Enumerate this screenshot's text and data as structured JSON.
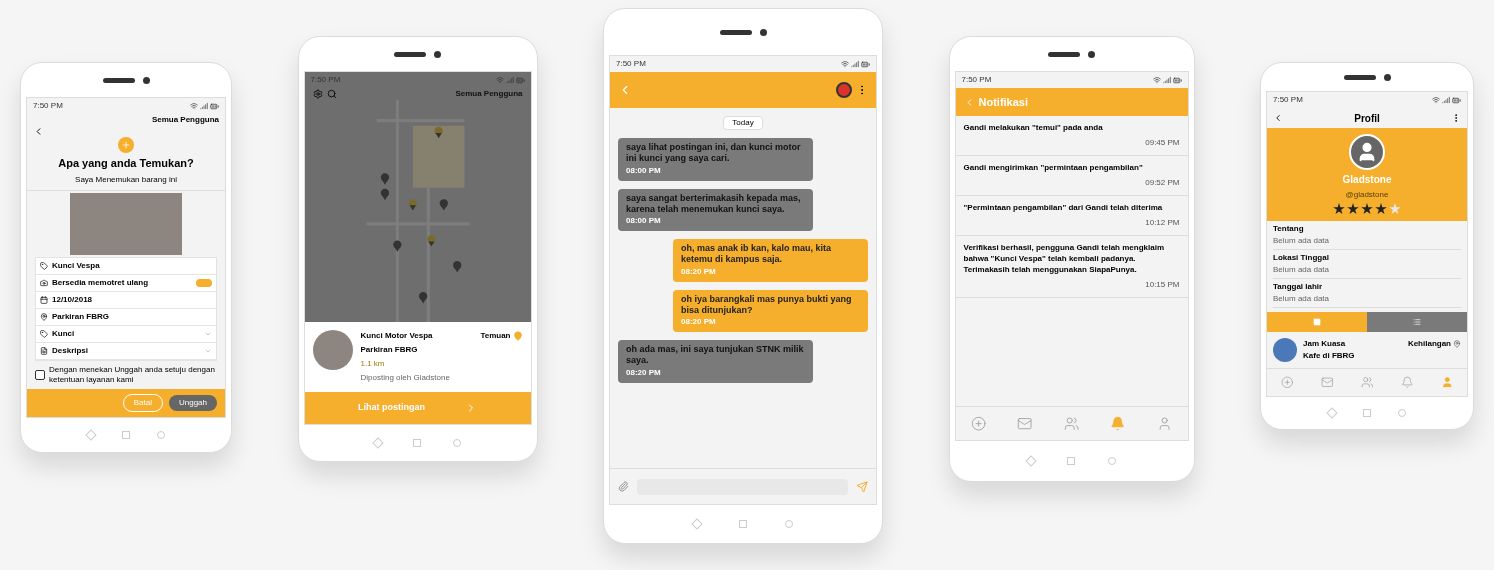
{
  "report_screen": {
    "status_time": "7:50 PM",
    "user_filter": "Semua Pengguna",
    "title": "Apa yang anda Temukan?",
    "subtitle": "Saya Menemukan barang ini",
    "fields": [
      {
        "kind": "text",
        "value": "Kunci Vespa"
      },
      {
        "kind": "toggle",
        "value": "Bersedia memotret ulang",
        "on": true
      },
      {
        "kind": "text",
        "value": "12/10/2018"
      },
      {
        "kind": "text",
        "value": "Parkiran FBRG"
      },
      {
        "kind": "select",
        "value": "Kunci"
      },
      {
        "kind": "select",
        "value": "Deskripsi"
      }
    ],
    "agreement": {
      "checked": false,
      "text": "Dengan menekan Unggah anda setuju dengan ketentuan layanan kami"
    },
    "buttons": [
      {
        "label": "Batal",
        "kind": "outline"
      },
      {
        "label": "Unggah",
        "kind": "filled"
      }
    ]
  },
  "map_screen": {
    "status_time": "7:50 PM",
    "user_filter": "Semua Pengguna",
    "item_title": "Kunci Motor Vespa",
    "item_place": "Parkiran FBRG",
    "distance": "1.1 km",
    "posted_by": "Diposting oleh Gladstone",
    "type_label": "Temuan",
    "action": "Lihat postingan"
  },
  "chat_screen": {
    "status_time": "7:50 PM",
    "date_chip": "Today",
    "messages": [
      {
        "mine": false,
        "text": "saya lihat postingan ini, dan kunci motor ini kunci yang saya cari.",
        "time": "08:00 PM"
      },
      {
        "mine": false,
        "text": "saya sangat berterimakasih kepada mas, karena telah menemukan kunci saya.",
        "time": "08:00 PM"
      },
      {
        "mine": true,
        "text": "oh, mas anak ib kan, kalo mau, kita ketemu di kampus saja.",
        "time": "08:20 PM"
      },
      {
        "mine": true,
        "text": "oh iya barangkali mas punya bukti yang bisa ditunjukan?",
        "time": "08:20 PM"
      },
      {
        "mine": false,
        "text": "oh ada mas, ini saya tunjukan STNK milik saya.",
        "time": "08:20 PM"
      }
    ]
  },
  "notification_screen": {
    "status_time": "7:50 PM",
    "title": "Notifikasi",
    "items": [
      {
        "text": "Gandi melakukan \"temui\" pada anda",
        "time": "09:45 PM"
      },
      {
        "text": "Gandi mengirimkan \"permintaan pengambilan\"",
        "time": "09:52 PM"
      },
      {
        "text": "\"Permintaan pengambilan\" dari Gandi telah diterima",
        "time": "10:12 PM"
      },
      {
        "text": "Verifikasi berhasil, pengguna Gandi telah mengklaim bahwa \"Kunci Vespa\" telah kembali padanya. Terimakasih telah menggunakan SiapaPunya.",
        "time": "10:15 PM"
      }
    ],
    "nav": [
      {
        "selected": false
      },
      {
        "selected": false
      },
      {
        "selected": false
      },
      {
        "selected": true
      },
      {
        "selected": false
      }
    ]
  },
  "profile_screen": {
    "status_time": "7:50 PM",
    "title": "Profil",
    "name": "Gladstone",
    "handle": "@gladstone",
    "stars": 4,
    "details": [
      {
        "label": "Tentang",
        "value": "Belum ada data"
      },
      {
        "label": "Lokasi Tinggal",
        "value": "Belum ada data"
      },
      {
        "label": "Tanggal lahir",
        "value": "Belum ada data"
      }
    ],
    "tabs": [
      {
        "selected": true
      },
      {
        "selected": false
      }
    ],
    "post": {
      "title": "Jam Kuasa",
      "place": "Kafe di FBRG",
      "type_label": "Kehilangan"
    },
    "nav": [
      {
        "selected": false
      },
      {
        "selected": false
      },
      {
        "selected": false
      },
      {
        "selected": false
      },
      {
        "selected": true
      }
    ]
  }
}
